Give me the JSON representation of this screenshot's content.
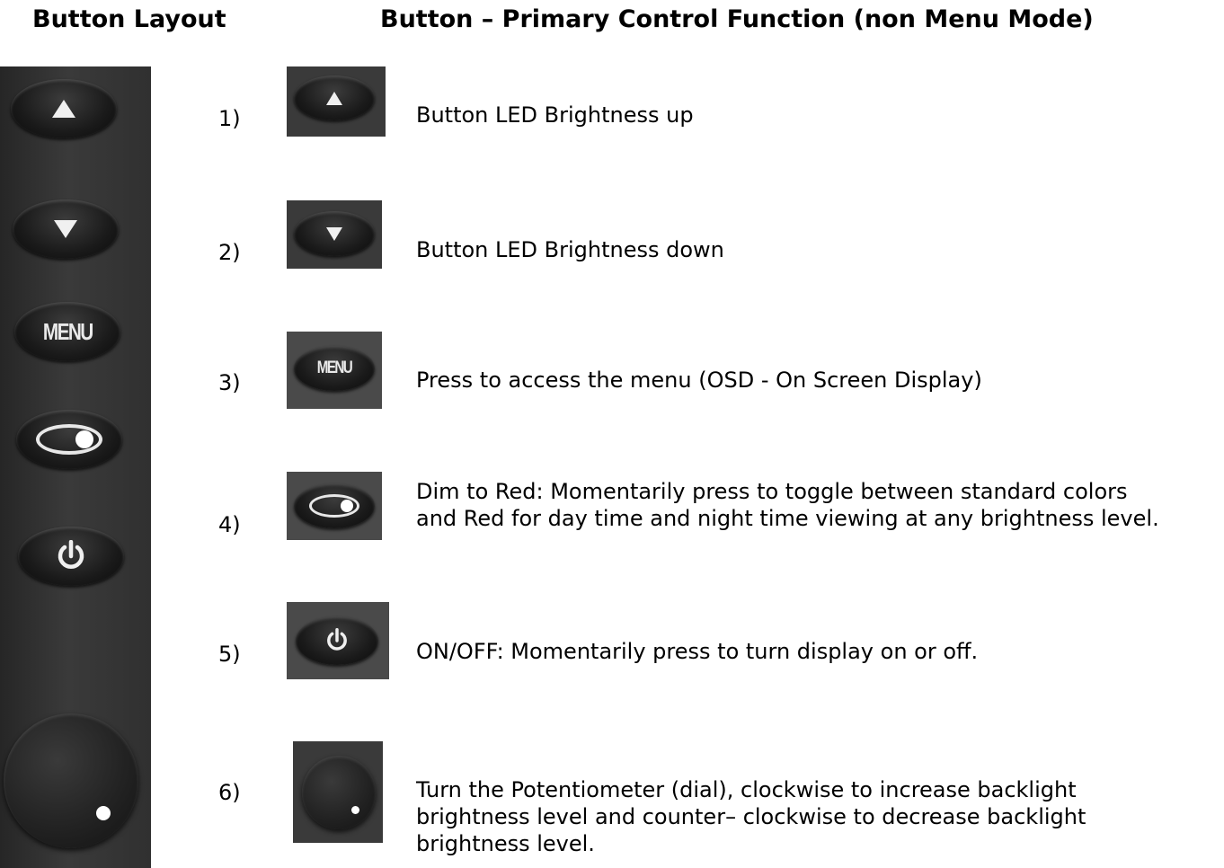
{
  "headings": {
    "left": "Button Layout",
    "right": "Button – Primary Control Function (non Menu Mode)"
  },
  "panel": {
    "menu_label": "MENU"
  },
  "items": [
    {
      "number": "1)",
      "icon": "up-arrow-button",
      "lines": [
        "Button LED Brightness up"
      ]
    },
    {
      "number": "2)",
      "icon": "down-arrow-button",
      "lines": [
        "Button LED Brightness down"
      ]
    },
    {
      "number": "3)",
      "icon": "menu-button",
      "lines": [
        "Press to access the menu (OSD - On Screen Display)"
      ]
    },
    {
      "number": "4)",
      "icon": "dim-to-red-button",
      "lines": [
        "Dim to Red: Momentarily press to toggle between standard colors",
        "and Red for day time and night time viewing at any brightness level."
      ]
    },
    {
      "number": "5)",
      "icon": "power-button",
      "lines": [
        "ON/OFF: Momentarily press to turn display on or off."
      ]
    },
    {
      "number": "6)",
      "icon": "potentiometer-dial",
      "lines": [
        "Turn the Potentiometer (dial), clockwise to increase backlight",
        "brightness level and counter– clockwise to decrease backlight",
        "brightness level."
      ]
    }
  ],
  "colors": {
    "panel_background": "#2e2e2e",
    "button_body": "#141414",
    "glyph": "#f0f0f0"
  }
}
